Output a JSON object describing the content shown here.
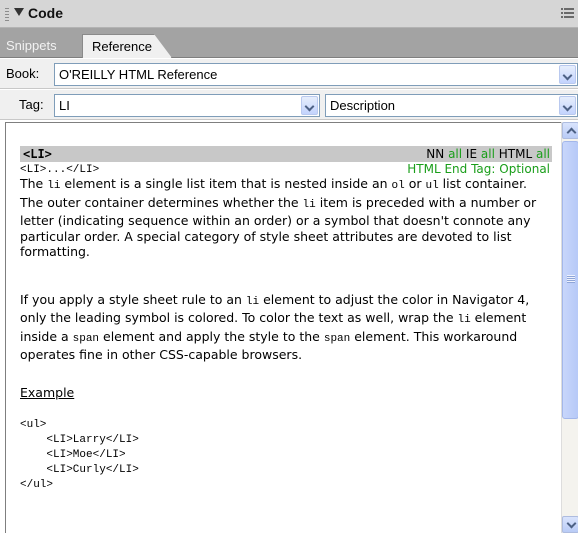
{
  "panel": {
    "title": "Code"
  },
  "tabs": [
    {
      "label": "Snippets",
      "active": false
    },
    {
      "label": "Reference",
      "active": true
    }
  ],
  "book": {
    "label": "Book:",
    "value": "O'REILLY HTML Reference"
  },
  "tag": {
    "label": "Tag:",
    "value": "LI",
    "view": "Description"
  },
  "doc": {
    "tag_name": "<LI>",
    "compat_nn": "NN",
    "compat_nn_val": "all",
    "compat_ie": "IE",
    "compat_ie_val": "all",
    "compat_html": "HTML",
    "compat_html_val": "all",
    "syntax": "<LI>...</LI>",
    "end_tag": "HTML End Tag: Optional",
    "p1_a": "The ",
    "p1_code1": "li",
    "p1_b": " element is a single list item that is nested inside an ",
    "p1_code2": "ol",
    "p1_c": " or ",
    "p1_code3": "ul",
    "p1_d": " list container. The outer container determines whether the ",
    "p1_code4": "li",
    "p1_e": " item is preceded with a number or letter (indicating sequence within an order) or a symbol that doesn't connote any particular order. A special category of style sheet attributes are devoted to list formatting.",
    "p2_a": "If you apply a style sheet rule to an ",
    "p2_code1": "li",
    "p2_b": " element to adjust the color in Navigator 4, only the leading symbol is colored. To color the text as well, wrap the ",
    "p2_code2": "li",
    "p2_c": " element inside a ",
    "p2_code3": "span",
    "p2_d": " element and apply the style to the ",
    "p2_code4": "span",
    "p2_e": " element. This workaround operates fine in other CSS-capable browsers.",
    "example_heading": "Example",
    "example_code": "<ul>\n    <LI>Larry</LI>\n    <LI>Moe</LI>\n    <LI>Curly</LI>\n</ul>"
  },
  "colors": {
    "compat_green": "#1a9e1a",
    "tag_bar": "#c8c8c8"
  }
}
